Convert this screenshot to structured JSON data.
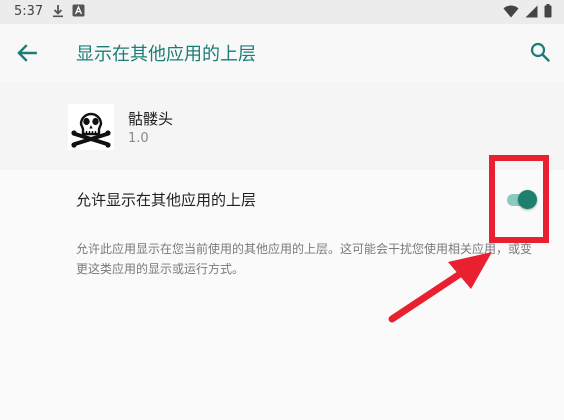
{
  "status_bar": {
    "time": "5:37",
    "left_icons": [
      "download-icon",
      "notification-a-icon"
    ],
    "right_icons": [
      "wifi-icon",
      "signal-icon",
      "battery-icon"
    ]
  },
  "app_bar": {
    "title": "显示在其他应用的上层",
    "back_icon": "arrow-back-icon",
    "search_icon": "search-icon"
  },
  "app_info": {
    "name": "骷髅头",
    "version": "1.0",
    "icon": "skull-crossbones-icon"
  },
  "setting": {
    "label": "允许显示在其他应用的上层",
    "toggle_on": true,
    "summary": "允许此应用显示在您当前使用的其他应用的上层。这可能会干扰您使用相关应用，或变更这类应用的显示或运行方式。"
  },
  "colors": {
    "accent": "#1a7e77",
    "toggle_thumb": "#1d7f6e",
    "toggle_track": "#8bc9c1",
    "annotation": "#e8202f"
  }
}
